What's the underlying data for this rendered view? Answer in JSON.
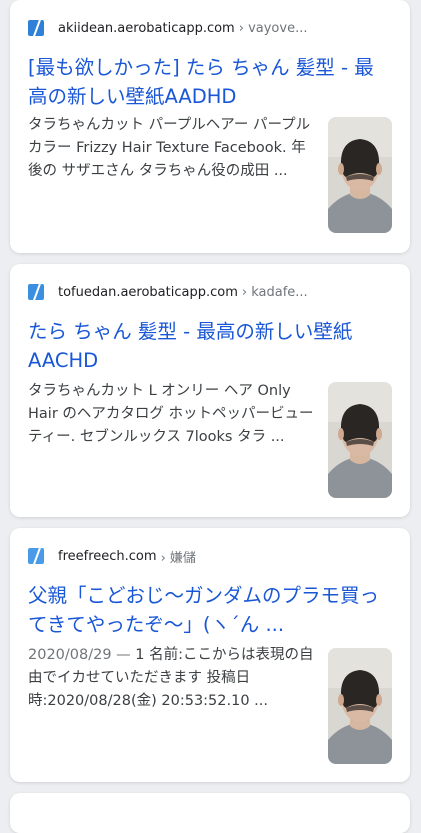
{
  "results": [
    {
      "domain": "akiidean.aerobaticapp.com",
      "path": "› vayove...",
      "title": "[最も欲しかった] たら ちゃん 髪型 - 最高の新しい壁紙AADHD",
      "snippet": "タラちゃんカット パープルヘアー パープルカラー Frizzy Hair Texture Facebook. 年後の サザエさん タラちゃん役の成田 ...",
      "thumb_icon": "boy-haircut-back-photo"
    },
    {
      "domain": "tofuedan.aerobaticapp.com",
      "path": "› kadafe...",
      "title": "たら ちゃん 髪型 - 最高の新しい壁紙AACHD",
      "snippet": "タラちゃんカット L オンリー ヘア Only Hair のヘアカタログ ホットペッパービューティー. セブンルックス 7looks タラ ...",
      "thumb_icon": "boy-haircut-back-photo"
    },
    {
      "domain": "freefreech.com",
      "path": "› 嫌儲",
      "title": "父親「こどおじ〜ガンダムのプラモ買ってきてやったぞ〜」(ヽ´ん ...",
      "date": "2020/08/29 — ",
      "snippet": "1 名前:ここからは表現の自由でイカせていただきます 投稿日時:2020/08/28(金) 20:53:52.10 ...",
      "thumb_icon": "boy-haircut-back-photo"
    }
  ]
}
